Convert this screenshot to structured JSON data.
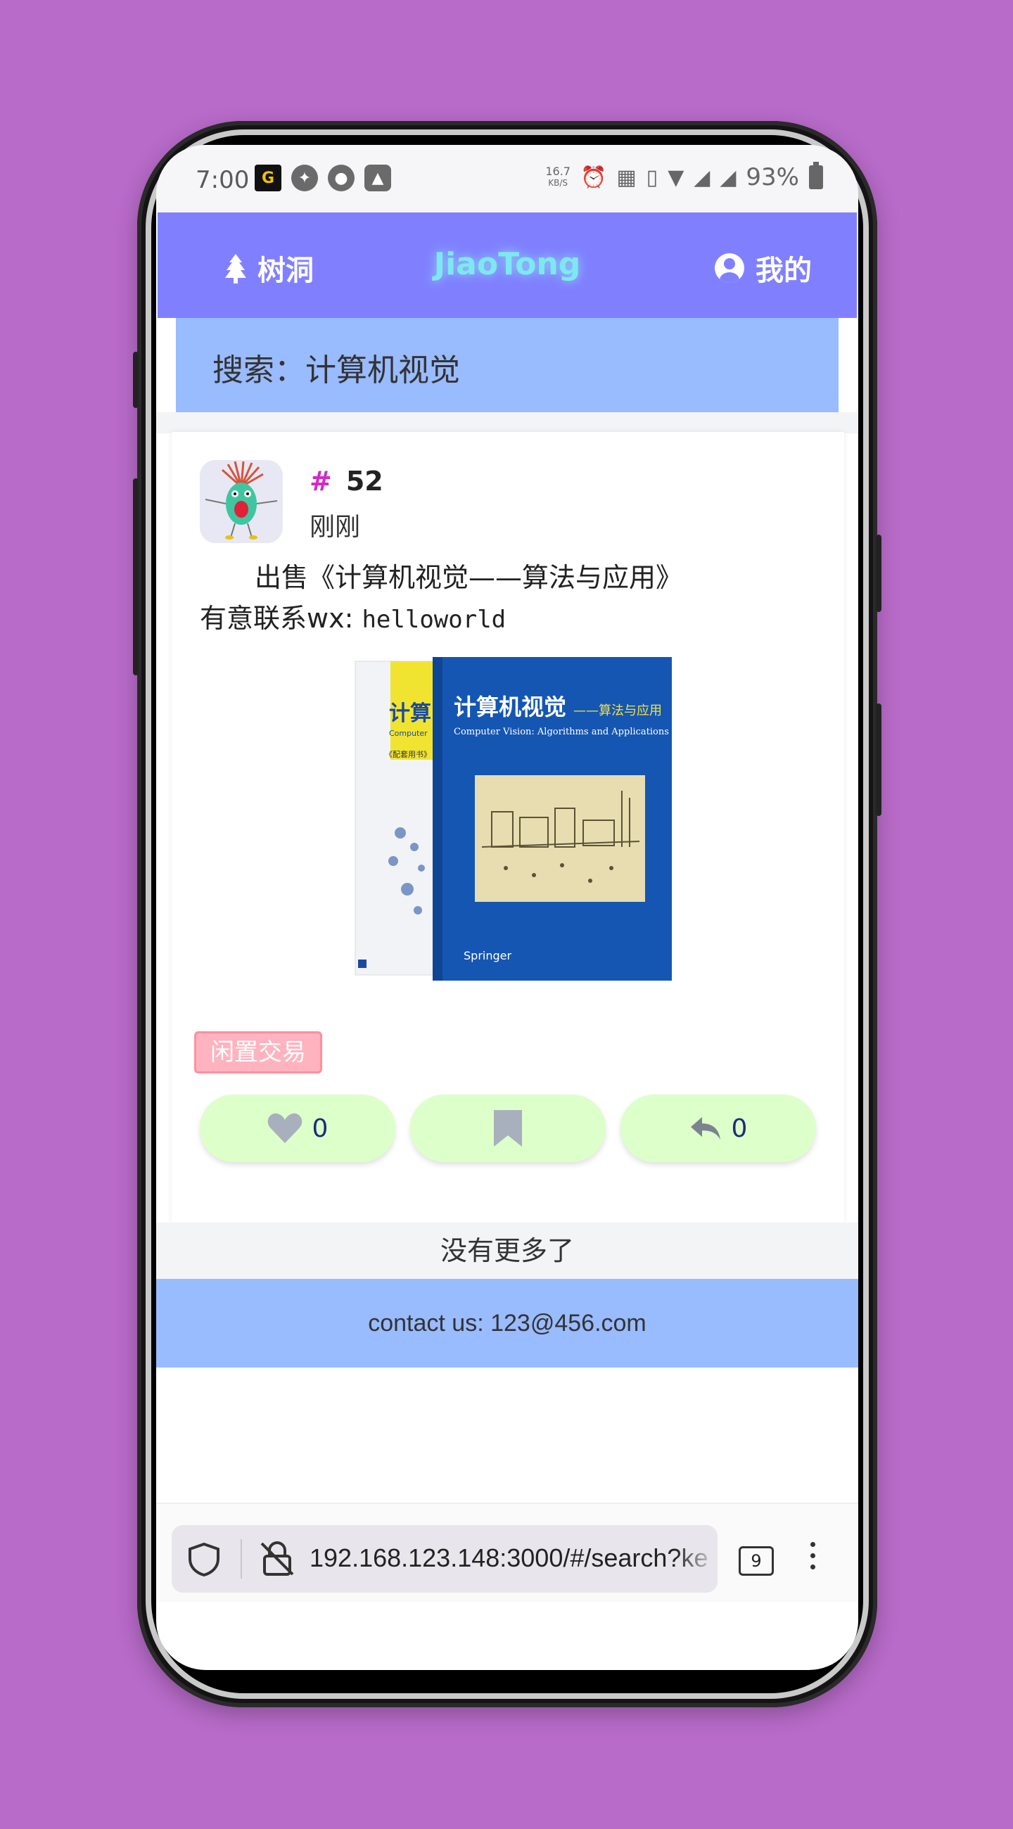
{
  "status_bar": {
    "time": "7:00",
    "network_speed_value": "16.7",
    "network_speed_unit": "KB/S",
    "battery": "93%"
  },
  "header": {
    "left_label": "树洞",
    "title": "JiaoTong",
    "right_label": "我的"
  },
  "search": {
    "label": "搜索：计算机视觉"
  },
  "post": {
    "hash": "#",
    "number": "52",
    "time": "刚刚",
    "line1": "出售《计算机视觉——算法与应用》",
    "line2_prefix": "有意联系wx: ",
    "line2_id": "helloworld",
    "tag": "闲置交易",
    "like_count": "0",
    "reply_count": "0",
    "book_cover_title": "计算机视觉",
    "book_cover_subtitle": "——算法与应用",
    "book_cover_en": "Computer Vision: Algorithms and Applications",
    "book_publisher": "Springer",
    "book_back_title": "计算",
    "book_back_en": "Computer",
    "book_back_note": "《配套用书》"
  },
  "list": {
    "no_more": "没有更多了"
  },
  "footer": {
    "contact": "contact us: 123@456.com"
  },
  "browser": {
    "url": "192.168.123.148:3000/#/search?ke",
    "tabs": "9"
  },
  "colors": {
    "background": "#b86bc9",
    "header": "#8080ff",
    "search_bar": "#99bbff",
    "title_glow": "#7ee8f0",
    "action_button": "#ddffc9",
    "tag": "#ffb3bf",
    "hash": "#d12bc8"
  }
}
